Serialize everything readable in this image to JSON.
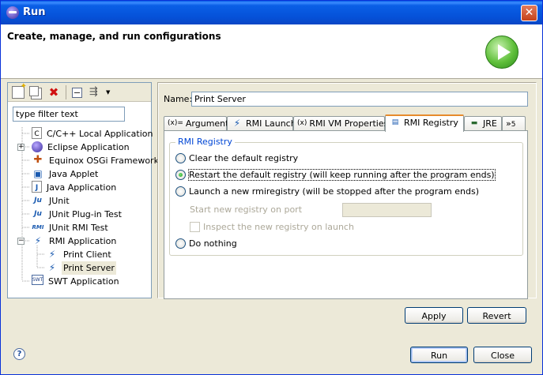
{
  "window": {
    "title": "Run",
    "close_glyph": "✕"
  },
  "header": {
    "title": "Create, manage, and run configurations",
    "icon": "run-icon"
  },
  "left": {
    "toolbar": [
      {
        "name": "new-launch-configuration-icon"
      },
      {
        "name": "duplicate-icon"
      },
      {
        "name": "delete-icon",
        "glyph": "✖"
      },
      {
        "name": "collapse-all-icon"
      },
      {
        "name": "filter-icon",
        "glyph": "⇶"
      },
      {
        "name": "dropdown-arrow-icon",
        "glyph": "▼"
      }
    ],
    "filter": {
      "value": "type filter text",
      "placeholder": "type filter text"
    },
    "tree": [
      {
        "label": "C/C++ Local Application",
        "icon": "c-file-icon",
        "glyph": "C"
      },
      {
        "label": "Eclipse Application",
        "icon": "eclipse-icon",
        "expander": "+"
      },
      {
        "label": "Equinox OSGi Framework",
        "icon": "osgi-icon",
        "glyph": "✚"
      },
      {
        "label": "Java Applet",
        "icon": "applet-icon",
        "glyph": "▣"
      },
      {
        "label": "Java Application",
        "icon": "java-app-icon",
        "glyph": "J"
      },
      {
        "label": "JUnit",
        "icon": "junit-icon",
        "glyph": "Ju"
      },
      {
        "label": "JUnit Plug-in Test",
        "icon": "junit-plugin-icon",
        "glyph": "Ju"
      },
      {
        "label": "JUnit RMI Test",
        "icon": "junit-rmi-icon",
        "glyph": "RMI"
      },
      {
        "label": "RMI Application",
        "icon": "rmi-app-icon",
        "expander": "−",
        "glyph": "⚡"
      },
      {
        "label": "Print Client",
        "icon": "rmi-config-icon",
        "glyph": "⚡"
      },
      {
        "label": "Print Server",
        "icon": "rmi-config-icon",
        "glyph": "⚡",
        "selected": true
      },
      {
        "label": "SWT Application",
        "icon": "swt-icon",
        "glyph": "SWT"
      }
    ]
  },
  "right": {
    "name_label": "Name:",
    "name_value": "Print Server",
    "tabs": [
      {
        "label": "Arguments",
        "icon_glyph": "(x)="
      },
      {
        "label": "RMI Launch",
        "icon_glyph": "⚡"
      },
      {
        "label": "RMI VM Properties",
        "icon_glyph": "(x)"
      },
      {
        "label": "RMI Registry",
        "icon_glyph": "▤",
        "active": true
      },
      {
        "label": "JRE",
        "icon_glyph": "▬"
      },
      {
        "label": "5",
        "icon_glyph": "»"
      }
    ],
    "group_title": "RMI Registry",
    "options": {
      "clear": "Clear the default registry",
      "restart": "Restart the default registry (will keep running after the program ends)",
      "launch_new": "Launch a new rmiregistry (will be stopped after the program ends)",
      "port_label": "Start new registry on port",
      "port_value": "",
      "inspect": "Inspect the new registry on launch",
      "nothing": "Do nothing"
    },
    "apply": "Apply",
    "revert": "Revert"
  },
  "footer": {
    "help_glyph": "?",
    "run": "Run",
    "close": "Close"
  }
}
